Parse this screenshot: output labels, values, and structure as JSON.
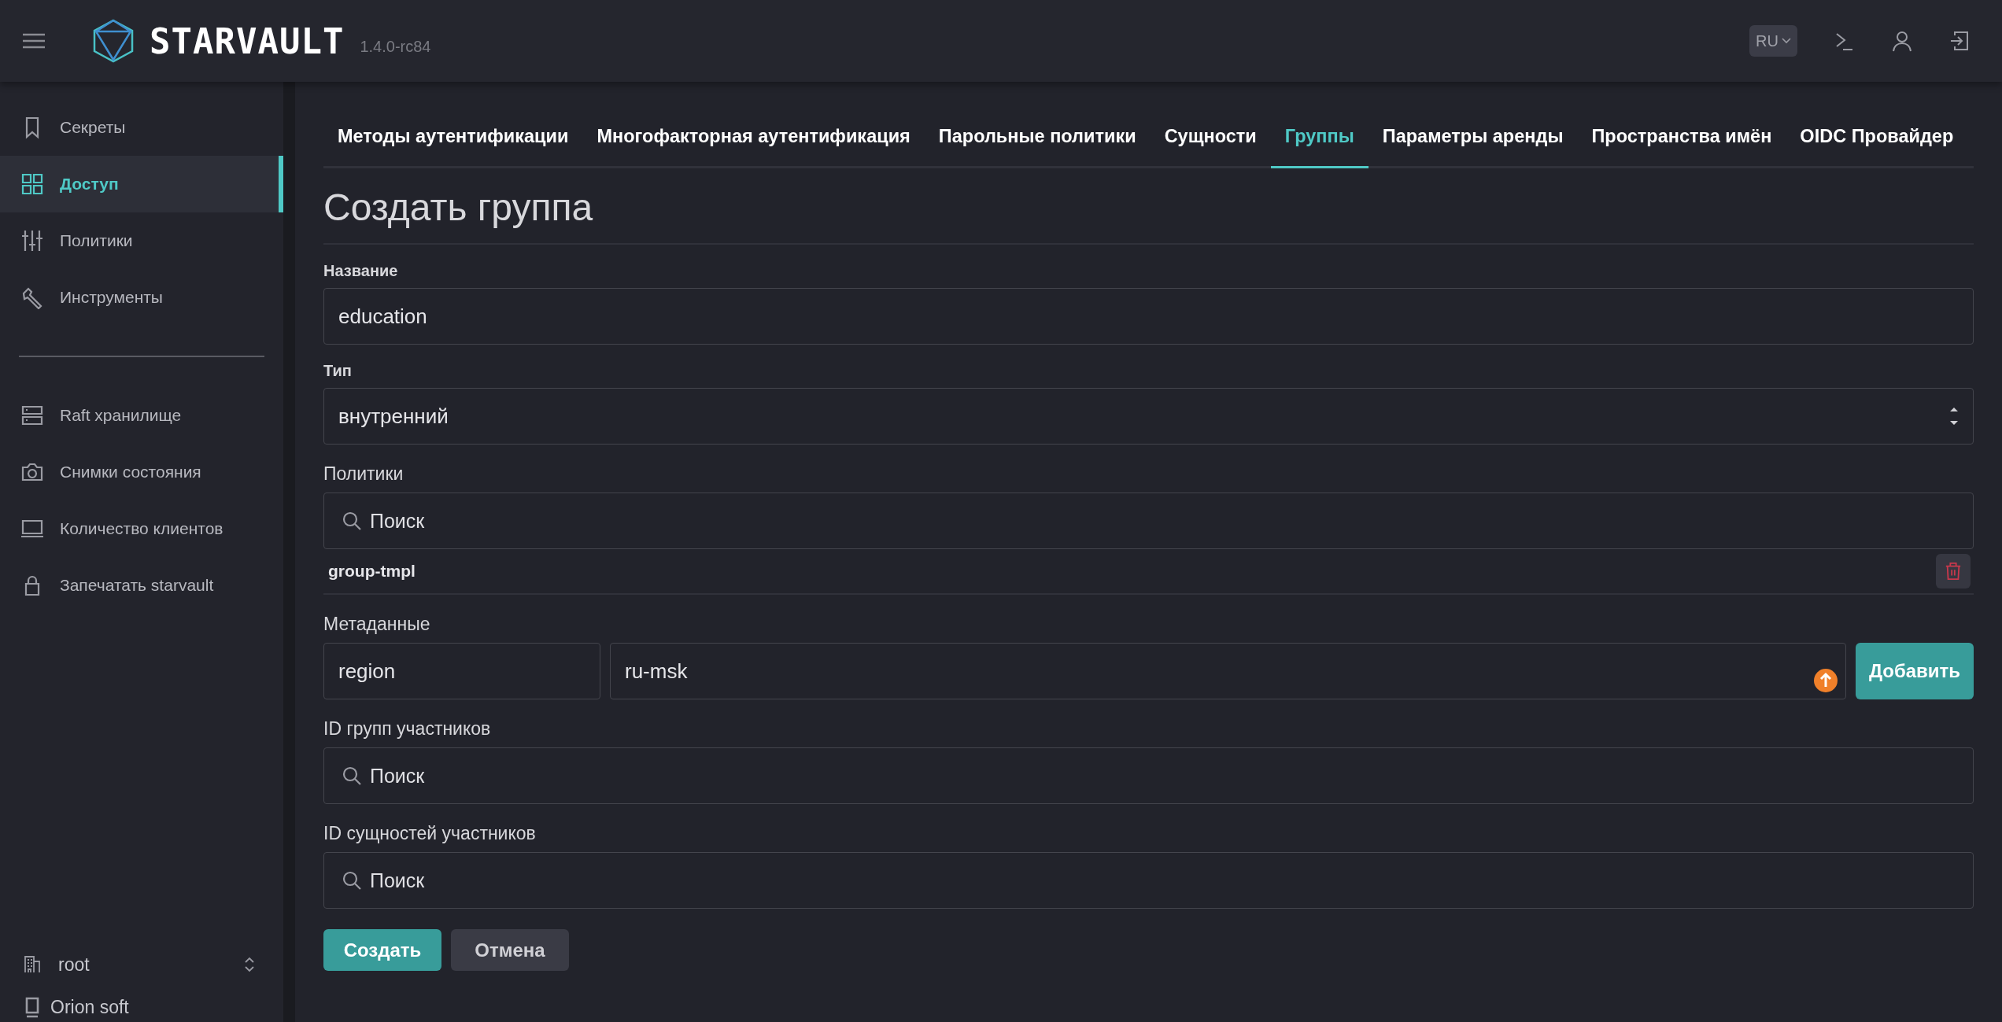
{
  "header": {
    "logo": "STARVAULT",
    "version": "1.4.0-rc84",
    "language": "RU"
  },
  "sidebar": {
    "groups": [
      [
        {
          "label": "Секреты",
          "selected": false
        },
        {
          "label": "Доступ",
          "selected": true
        },
        {
          "label": "Политики",
          "selected": false
        },
        {
          "label": "Инструменты",
          "selected": false
        }
      ],
      [
        {
          "label": "Raft хранилище",
          "selected": false
        },
        {
          "label": "Снимки состояния",
          "selected": false
        },
        {
          "label": "Количество клиентов",
          "selected": false
        },
        {
          "label": "Запечатать starvault",
          "selected": false
        }
      ]
    ],
    "namespace": "root",
    "brand": "Orion soft"
  },
  "tabs": [
    {
      "label": "Методы аутентификации",
      "selected": false
    },
    {
      "label": "Многофакторная аутентификация",
      "selected": false
    },
    {
      "label": "Парольные политики",
      "selected": false
    },
    {
      "label": "Сущности",
      "selected": false
    },
    {
      "label": "Группы",
      "selected": true
    },
    {
      "label": "Параметры аренды",
      "selected": false
    },
    {
      "label": "Пространства имён",
      "selected": false
    },
    {
      "label": "OIDC Провайдер",
      "selected": false
    }
  ],
  "title": "Создать группа",
  "fields": [
    {
      "kind": "text",
      "label": "Название",
      "value": "education"
    },
    {
      "kind": "select",
      "label": "Тип",
      "value": "внутренний"
    },
    {
      "kind": "search",
      "label": "Политики",
      "placeholder": "Поиск",
      "items": [
        "group-tmpl"
      ]
    },
    {
      "kind": "keyvalue",
      "label": "Метаданные",
      "key": "region",
      "value": "ru-msk",
      "button": "Добавить"
    },
    {
      "kind": "search",
      "label": "ID групп участников",
      "placeholder": "Поиск"
    },
    {
      "kind": "search",
      "label": "ID сущностей участников",
      "placeholder": "Поиск"
    }
  ],
  "buttons": [
    {
      "label": "Создать",
      "kind": "primary"
    },
    {
      "label": "Отмена",
      "kind": "secondary"
    }
  ]
}
